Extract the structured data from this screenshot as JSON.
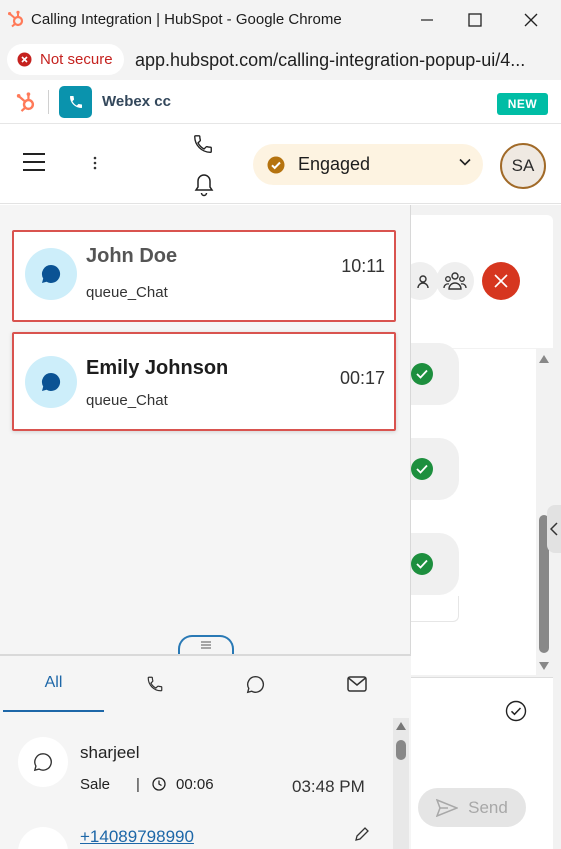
{
  "window": {
    "title": "Calling Integration | HubSpot - Google Chrome"
  },
  "addressbar": {
    "security_label": "Not secure",
    "url": "app.hubspot.com/calling-integration-popup-ui/4..."
  },
  "app": {
    "name": "Webex cc",
    "badge": "NEW"
  },
  "toolbar": {
    "state_label": "Engaged",
    "avatar_initials": "SA"
  },
  "tasks": [
    {
      "name": "John Doe",
      "queue": "queue_Chat",
      "timer": "10:11"
    },
    {
      "name": "Emily Johnson",
      "queue": "queue_Chat",
      "timer": "00:17"
    }
  ],
  "interaction_panel": {
    "send_label": "Send"
  },
  "activity": {
    "tabs": [
      "All"
    ],
    "items": [
      {
        "name": "sharjeel",
        "type": "Sale",
        "duration": "00:06",
        "time": "03:48 PM"
      },
      {
        "phone": "+14089798990"
      }
    ]
  },
  "colors": {
    "hubspot_orange": "#ff7a59",
    "webex_teal": "#0a93ad",
    "new_badge": "#00bda5",
    "engaged_bg": "#fdf3e1",
    "highlight_border": "#d9534f",
    "end_call_red": "#d6361f",
    "link_blue": "#1d67a8"
  }
}
